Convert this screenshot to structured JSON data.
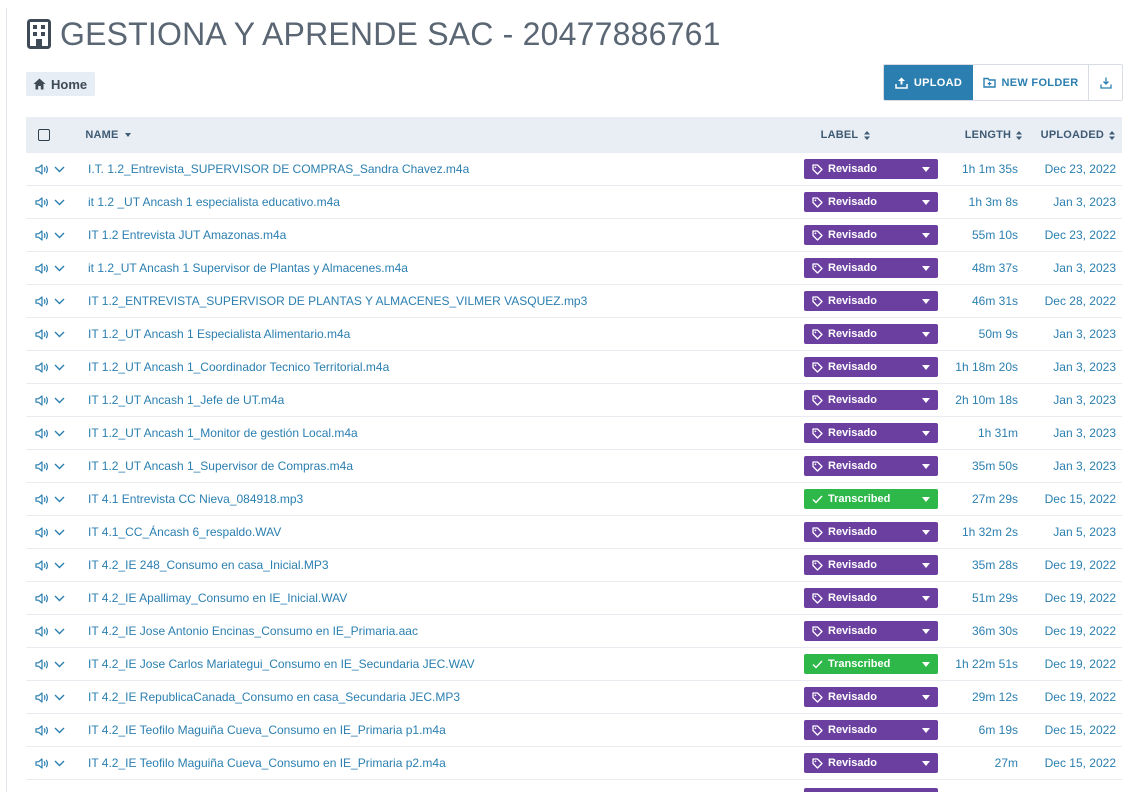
{
  "title": "GESTIONA Y APRENDE SAC - 20477886761",
  "breadcrumb": {
    "home_label": "Home"
  },
  "toolbar": {
    "upload_label": "UPLOAD",
    "new_folder_label": "NEW FOLDER"
  },
  "table": {
    "headers": {
      "name": "NAME",
      "label": "LABEL",
      "length": "LENGTH",
      "uploaded": "UPLOADED"
    },
    "rows": [
      {
        "name": "I.T. 1.2_Entrevista_SUPERVISOR DE COMPRAS_Sandra Chavez.m4a",
        "label": "Revisado",
        "length": "1h 1m 35s",
        "uploaded": "Dec 23, 2022"
      },
      {
        "name": "it 1.2 _UT Ancash 1 especialista educativo.m4a",
        "label": "Revisado",
        "length": "1h 3m 8s",
        "uploaded": "Jan 3, 2023"
      },
      {
        "name": "IT 1.2 Entrevista JUT Amazonas.m4a",
        "label": "Revisado",
        "length": "55m 10s",
        "uploaded": "Dec 23, 2022"
      },
      {
        "name": "it 1.2_UT Ancash 1 Supervisor de Plantas y Almacenes.m4a",
        "label": "Revisado",
        "length": "48m 37s",
        "uploaded": "Jan 3, 2023"
      },
      {
        "name": "IT 1.2_ENTREVISTA_SUPERVISOR DE PLANTAS Y ALMACENES_VILMER VASQUEZ.mp3",
        "label": "Revisado",
        "length": "46m 31s",
        "uploaded": "Dec 28, 2022"
      },
      {
        "name": "IT 1.2_UT Ancash 1 Especialista Alimentario.m4a",
        "label": "Revisado",
        "length": "50m 9s",
        "uploaded": "Jan 3, 2023"
      },
      {
        "name": "IT 1.2_UT Ancash 1_Coordinador Tecnico Territorial.m4a",
        "label": "Revisado",
        "length": "1h 18m 20s",
        "uploaded": "Jan 3, 2023"
      },
      {
        "name": "IT 1.2_UT Ancash 1_Jefe de UT.m4a",
        "label": "Revisado",
        "length": "2h 10m 18s",
        "uploaded": "Jan 3, 2023"
      },
      {
        "name": "IT 1.2_UT Ancash 1_Monitor de gestión Local.m4a",
        "label": "Revisado",
        "length": "1h 31m",
        "uploaded": "Jan 3, 2023"
      },
      {
        "name": "IT 1.2_UT Ancash 1_Supervisor de Compras.m4a",
        "label": "Revisado",
        "length": "35m 50s",
        "uploaded": "Jan 3, 2023"
      },
      {
        "name": "IT 4.1 Entrevista CC Nieva_084918.mp3",
        "label": "Transcribed",
        "length": "27m 29s",
        "uploaded": "Dec 15, 2022"
      },
      {
        "name": "IT 4.1_CC_Áncash 6_respaldo.WAV",
        "label": "Revisado",
        "length": "1h 32m 2s",
        "uploaded": "Jan 5, 2023"
      },
      {
        "name": "IT 4.2_IE 248_Consumo en casa_Inicial.MP3",
        "label": "Revisado",
        "length": "35m 28s",
        "uploaded": "Dec 19, 2022"
      },
      {
        "name": "IT 4.2_IE Apallimay_Consumo en IE_Inicial.WAV",
        "label": "Revisado",
        "length": "51m 29s",
        "uploaded": "Dec 19, 2022"
      },
      {
        "name": "IT 4.2_IE Jose Antonio Encinas_Consumo en IE_Primaria.aac",
        "label": "Revisado",
        "length": "36m 30s",
        "uploaded": "Dec 19, 2022"
      },
      {
        "name": "IT 4.2_IE Jose Carlos Mariategui_Consumo en IE_Secundaria JEC.WAV",
        "label": "Transcribed",
        "length": "1h 22m 51s",
        "uploaded": "Dec 19, 2022"
      },
      {
        "name": "IT 4.2_IE RepublicaCanada_Consumo en casa_Secundaria JEC.MP3",
        "label": "Revisado",
        "length": "29m 12s",
        "uploaded": "Dec 19, 2022"
      },
      {
        "name": "IT 4.2_IE Teofilo Maguiña Cueva_Consumo en IE_Primaria p1.m4a",
        "label": "Revisado",
        "length": "6m 19s",
        "uploaded": "Dec 15, 2022"
      },
      {
        "name": "IT 4.2_IE Teofilo Maguiña Cueva_Consumo en IE_Primaria p2.m4a",
        "label": "Revisado",
        "length": "27m",
        "uploaded": "Dec 15, 2022"
      }
    ]
  },
  "icons": {
    "title": "building-icon",
    "home": "home-icon",
    "upload": "upload-icon",
    "new_folder": "new-folder-icon",
    "download": "download-icon",
    "play": "speaker-icon",
    "expand": "chevron-down-icon",
    "label_revisado": "tag-icon",
    "label_transcribed": "check-icon"
  },
  "colors": {
    "primary": "#2b7fb0",
    "revisado": "#6b3fa0",
    "transcribed": "#2eb84a",
    "header_bg": "#e9eef5"
  }
}
